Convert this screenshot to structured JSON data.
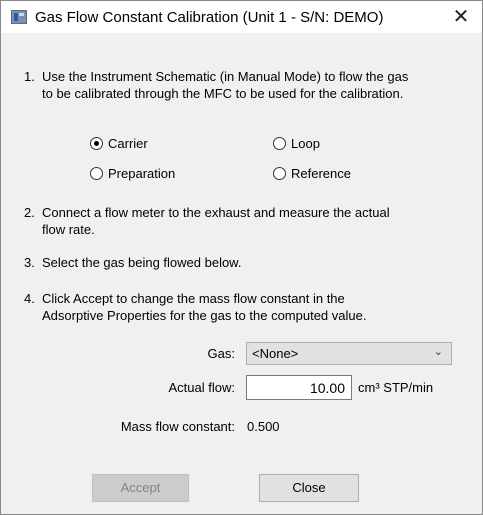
{
  "window": {
    "title": "Gas Flow Constant Calibration (Unit 1 - S/N: DEMO)",
    "close_glyph": "✕",
    "icon": "app-window-icon"
  },
  "steps": [
    {
      "num": "1.",
      "lines": [
        "Use the Instrument Schematic (in Manual Mode) to flow the gas",
        "to be calibrated through the MFC to be used for the calibration."
      ]
    },
    {
      "num": "2.",
      "lines": [
        "Connect a flow meter to the exhaust and measure the actual",
        "flow rate."
      ]
    },
    {
      "num": "3.",
      "lines": [
        "Select the gas being flowed below."
      ]
    },
    {
      "num": "4.",
      "lines": [
        "Click Accept to change the mass flow constant in the",
        "Adsorptive Properties for the gas to the computed value."
      ]
    }
  ],
  "radios": {
    "carrier": {
      "label": "Carrier",
      "selected": true
    },
    "loop": {
      "label": "Loop",
      "selected": false
    },
    "preparation": {
      "label": "Preparation",
      "selected": false
    },
    "reference": {
      "label": "Reference",
      "selected": false
    }
  },
  "form": {
    "gas_label": "Gas:",
    "gas_value": "<None>",
    "flow_label": "Actual flow:",
    "flow_value": "10.00",
    "flow_unit": "cm³ STP/min",
    "mfc_label": "Mass flow constant:",
    "mfc_value": "0.500"
  },
  "buttons": {
    "accept": {
      "label": "Accept",
      "enabled": false
    },
    "close": {
      "label": "Close",
      "enabled": true
    }
  },
  "colors": {
    "dialog_bg": "#f0f0f0",
    "titlebar_bg": "#ffffff",
    "disabled_text": "#838383"
  }
}
